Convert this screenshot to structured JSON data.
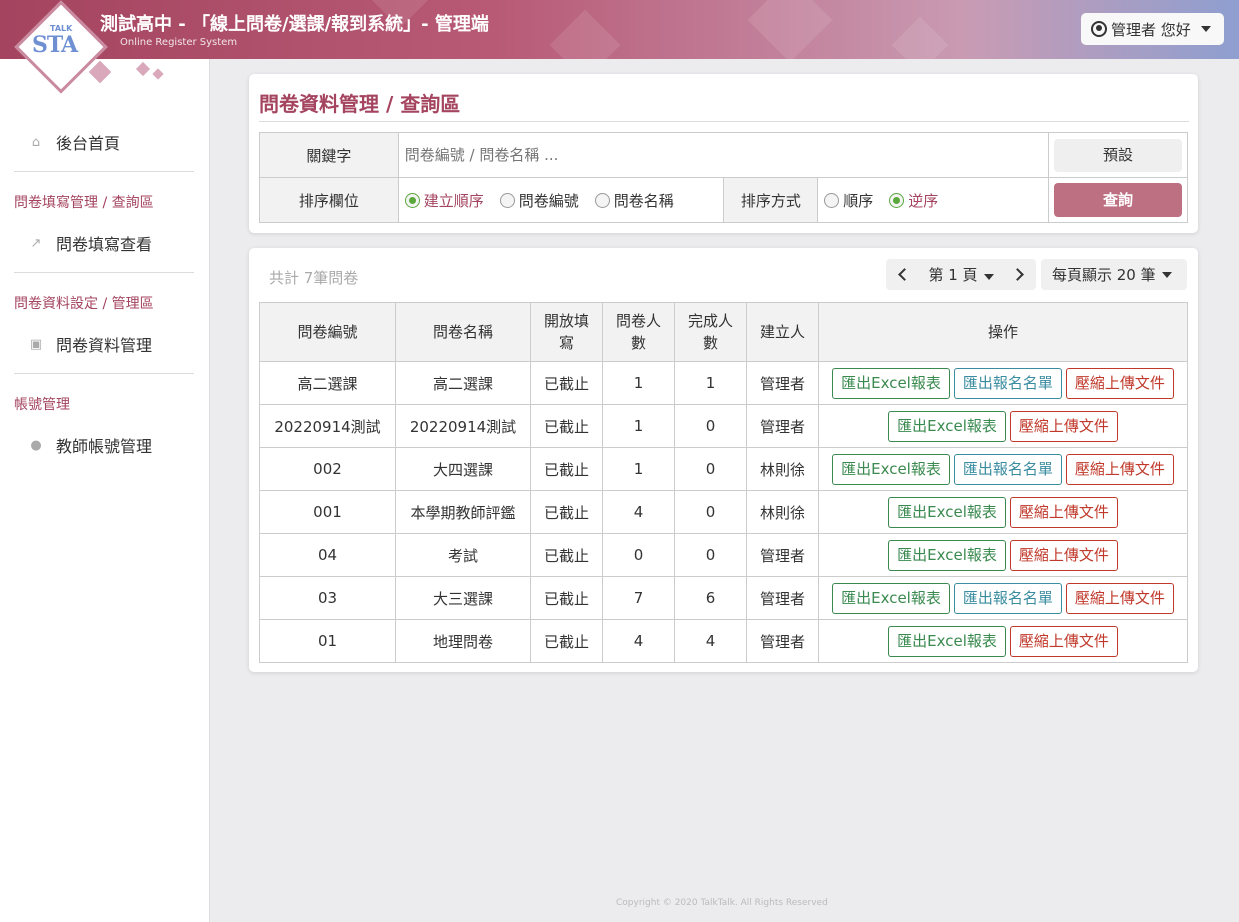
{
  "header": {
    "title": "測試高中 - 「線上問卷/選課/報到系統」- 管理端",
    "subtitle": "Online Register System",
    "logo_text": "TALK",
    "user_label": "管理者 您好"
  },
  "sidebar": {
    "home": "後台首頁",
    "section1": "問卷填寫管理 / 查詢區",
    "item_fill_view": "問卷填寫查看",
    "section2": "問卷資料設定 / 管理區",
    "item_data_mgmt": "問卷資料管理",
    "section3": "帳號管理",
    "item_teacher": "教師帳號管理"
  },
  "query": {
    "title": "問卷資料管理 / 查詢區",
    "keyword_label": "關鍵字",
    "keyword_placeholder": "問卷編號 / 問卷名稱 ...",
    "default_btn": "預設",
    "sort_field_label": "排序欄位",
    "sort_opts": [
      "建立順序",
      "問卷編號",
      "問卷名稱"
    ],
    "sort_selected": "建立順序",
    "sort_order_label": "排序方式",
    "order_opts": [
      "順序",
      "逆序"
    ],
    "order_selected": "逆序",
    "query_btn": "查詢"
  },
  "list": {
    "total": "共計 7筆問卷",
    "page": "第 1 頁",
    "per_page": "每頁顯示 20 筆",
    "headers": [
      "問卷編號",
      "問卷名稱",
      "開放填寫",
      "問卷人數",
      "完成人數",
      "建立人",
      "操作"
    ],
    "btn_excel": "匯出Excel報表",
    "btn_namelist": "匯出報名名單",
    "btn_upload": "壓縮上傳文件",
    "rows": [
      {
        "id": "高二選課",
        "name": "高二選課",
        "status": "已截止",
        "count": "1",
        "done": "1",
        "creator": "管理者",
        "namelist": true
      },
      {
        "id": "20220914測試",
        "name": "20220914測試",
        "status": "已截止",
        "count": "1",
        "done": "0",
        "creator": "管理者",
        "namelist": false
      },
      {
        "id": "002",
        "name": "大四選課",
        "status": "已截止",
        "count": "1",
        "done": "0",
        "creator": "林則徐",
        "namelist": true
      },
      {
        "id": "001",
        "name": "本學期教師評鑑",
        "status": "已截止",
        "count": "4",
        "done": "0",
        "creator": "林則徐",
        "namelist": false
      },
      {
        "id": "04",
        "name": "考試",
        "status": "已截止",
        "count": "0",
        "done": "0",
        "creator": "管理者",
        "namelist": false
      },
      {
        "id": "03",
        "name": "大三選課",
        "status": "已截止",
        "count": "7",
        "done": "6",
        "creator": "管理者",
        "namelist": true
      },
      {
        "id": "01",
        "name": "地理問卷",
        "status": "已截止",
        "count": "4",
        "done": "4",
        "creator": "管理者",
        "namelist": false
      }
    ]
  },
  "footer": "Copyright © 2020 TalkTalk. All Rights Reserved"
}
